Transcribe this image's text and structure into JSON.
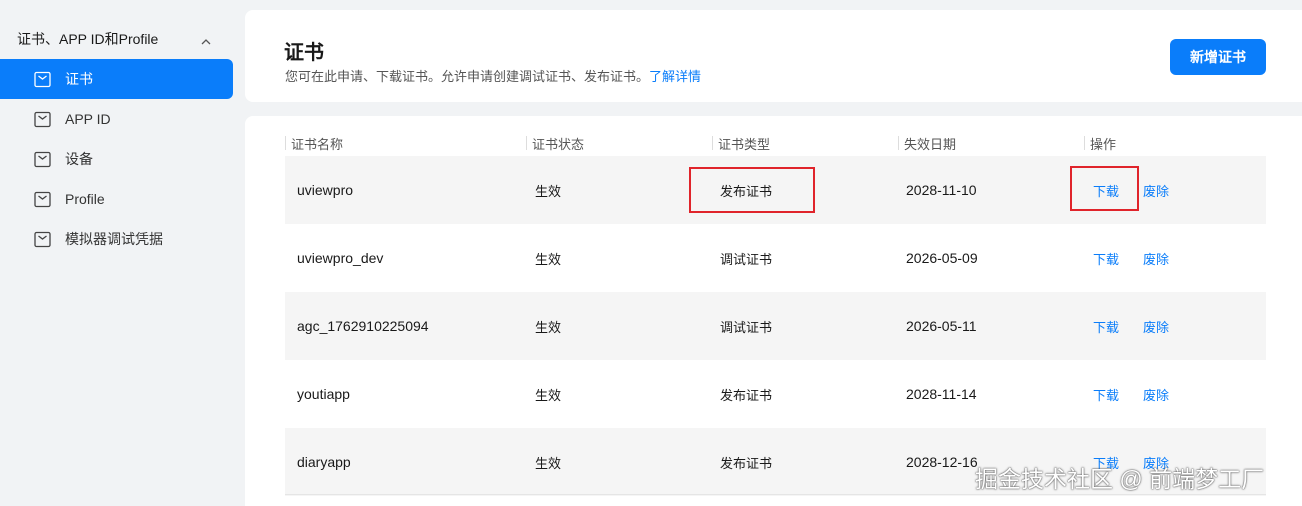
{
  "sidebar": {
    "group_label": "证书、APP ID和Profile",
    "items": [
      {
        "label": "证书",
        "active": true
      },
      {
        "label": "APP ID",
        "active": false
      },
      {
        "label": "设备",
        "active": false
      },
      {
        "label": "Profile",
        "active": false
      },
      {
        "label": "模拟器调试凭据",
        "active": false
      }
    ]
  },
  "header": {
    "title": "证书",
    "description": "您可在此申请、下载证书。允许申请创建调试证书、发布证书。",
    "learn_more": "了解详情",
    "add_button": "新增证书"
  },
  "table": {
    "columns": [
      "证书名称",
      "证书状态",
      "证书类型",
      "失效日期",
      "操作"
    ],
    "rows": [
      {
        "name": "uviewpro",
        "status": "生效",
        "type": "发布证书",
        "expiry": "2028-11-10",
        "download": "下载",
        "revoke": "废除"
      },
      {
        "name": "uviewpro_dev",
        "status": "生效",
        "type": "调试证书",
        "expiry": "2026-05-09",
        "download": "下载",
        "revoke": "废除"
      },
      {
        "name": "agc_1762910225094",
        "status": "生效",
        "type": "调试证书",
        "expiry": "2026-05-11",
        "download": "下载",
        "revoke": "废除"
      },
      {
        "name": "youtiapp",
        "status": "生效",
        "type": "发布证书",
        "expiry": "2028-11-14",
        "download": "下载",
        "revoke": "废除"
      },
      {
        "name": "diaryapp",
        "status": "生效",
        "type": "发布证书",
        "expiry": "2028-12-16",
        "download": "下载",
        "revoke": "废除"
      }
    ]
  },
  "watermark": "掘金技术社区 @ 前端梦工厂",
  "colors": {
    "accent": "#0a7dfa",
    "highlight": "#e0242b",
    "stripe": "#f5f5f5",
    "background": "#f1f3f5"
  },
  "icons": {
    "group_toggle": "chevron-up-icon",
    "nav_item": "folder-icon"
  }
}
